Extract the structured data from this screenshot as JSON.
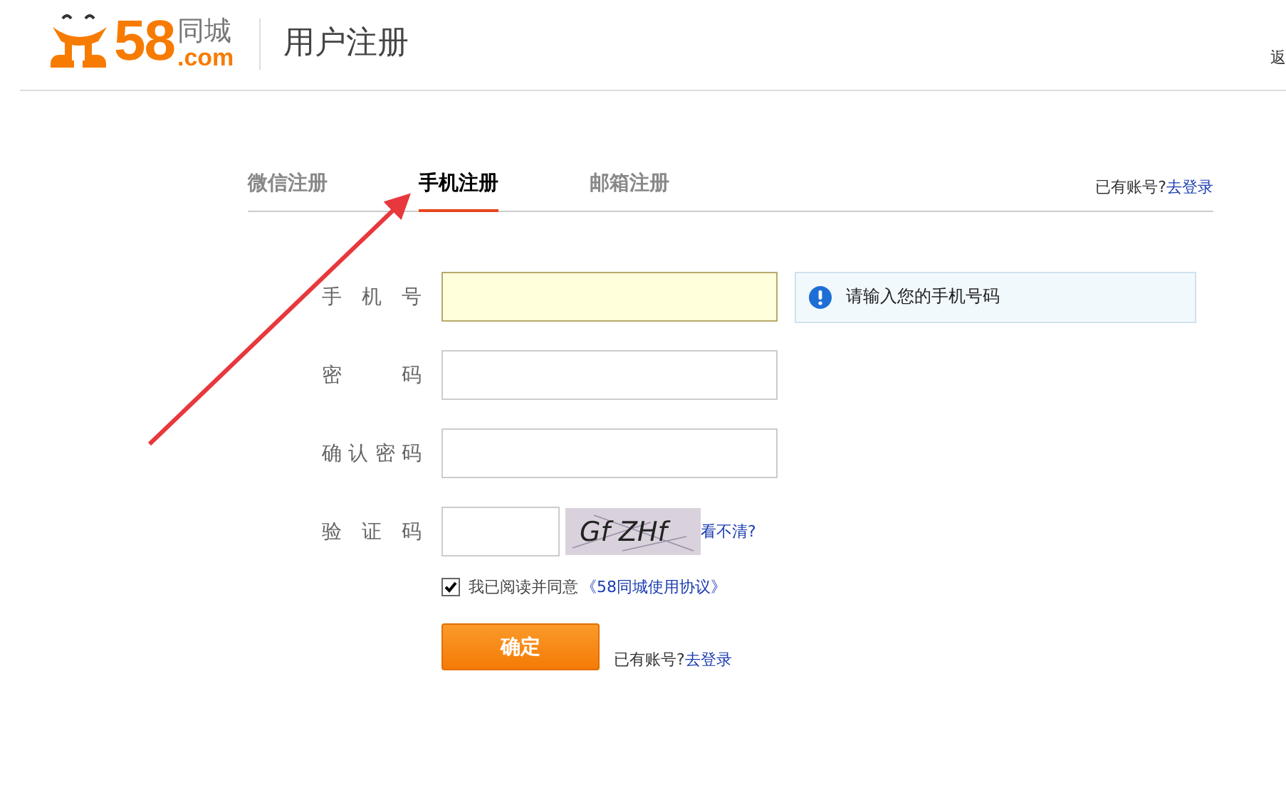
{
  "header": {
    "logo": {
      "number": "58",
      "name": "同城",
      "domain": ".com"
    },
    "title": "用户注册",
    "back_link": "返"
  },
  "tabs": [
    {
      "label": "微信注册",
      "selected": false
    },
    {
      "label": "手机注册",
      "selected": true
    },
    {
      "label": "邮箱注册",
      "selected": false
    }
  ],
  "login_prompt": {
    "text": "已有账号?",
    "link": "去登录"
  },
  "form": {
    "fields": [
      {
        "label": "手机号",
        "kind": "text",
        "focused": true
      },
      {
        "label": "密码",
        "kind": "text",
        "focused": false
      },
      {
        "label": "确认密码",
        "kind": "text",
        "focused": false
      },
      {
        "label": "验证码",
        "kind": "captcha",
        "focused": false,
        "captcha": "Gf ZHf",
        "refresh": "看不清?"
      }
    ],
    "hint": "请输入您的手机号码",
    "agreement": {
      "checked": true,
      "text": "我已阅读并同意",
      "link": "《58同城使用协议》"
    },
    "submit": "确定",
    "footer_prompt": {
      "text": "已有账号?",
      "link": "去登录"
    }
  }
}
